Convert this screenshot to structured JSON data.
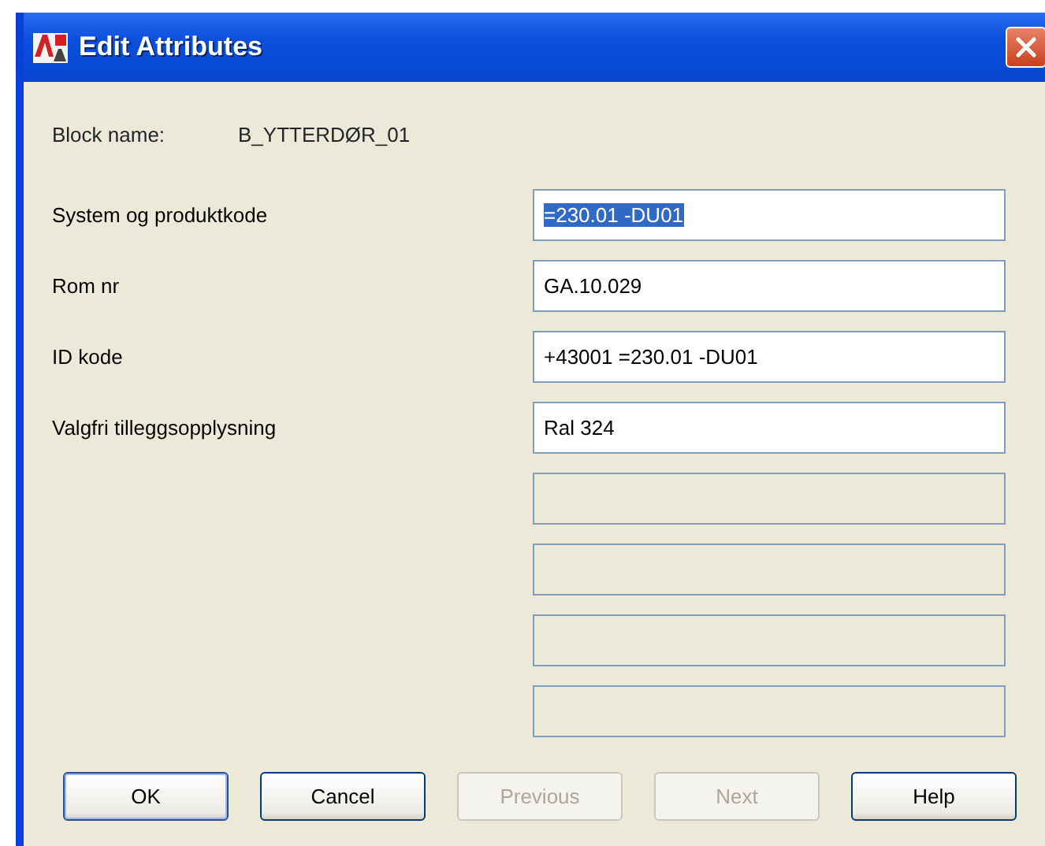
{
  "window": {
    "title": "Edit Attributes"
  },
  "block_name": {
    "label": "Block name:",
    "value": "B_YTTERDØR_01"
  },
  "attributes": [
    {
      "label": "System og produktkode",
      "value": "=230.01 -DU01",
      "highlighted": true
    },
    {
      "label": "Rom nr",
      "value": "GA.10.029",
      "highlighted": false
    },
    {
      "label": "ID kode",
      "value": "+43001 =230.01 -DU01",
      "highlighted": false
    },
    {
      "label": "Valgfri tilleggsopplysning",
      "value": "Ral 324",
      "highlighted": false
    }
  ],
  "blank_fields": [
    {
      "disabled": true
    },
    {
      "disabled": true
    },
    {
      "disabled": true
    },
    {
      "disabled": true
    }
  ],
  "buttons": [
    {
      "label": "OK",
      "disabled": false,
      "default": true
    },
    {
      "label": "Cancel",
      "disabled": false,
      "default": false
    },
    {
      "label": "Previous",
      "disabled": true,
      "default": false
    },
    {
      "label": "Next",
      "disabled": true,
      "default": false
    },
    {
      "label": "Help",
      "disabled": false,
      "default": false
    }
  ]
}
